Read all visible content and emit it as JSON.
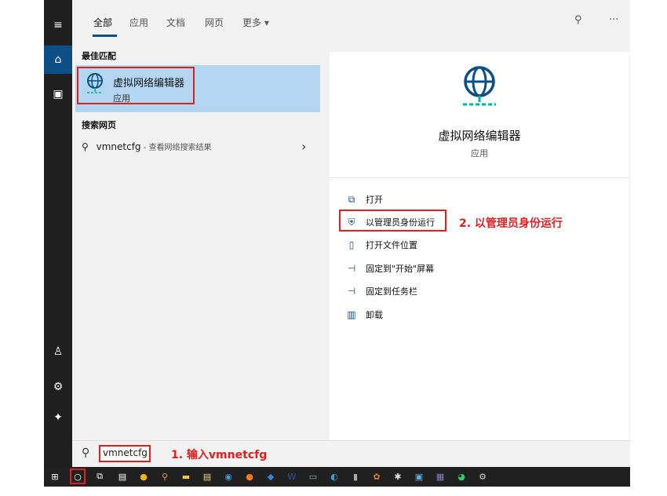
{
  "tabs": [
    "全部",
    "应用",
    "文档",
    "网页",
    "更多"
  ],
  "more_arrow": "▾",
  "top_icons": {
    "feedback": "⚲",
    "more": "···"
  },
  "left_bar": [
    "menu-icon",
    "home-icon",
    "document-icon",
    "user-icon",
    "settings-icon",
    "power-icon"
  ],
  "best_match": {
    "header": "最佳匹配",
    "name": "虚拟网络编辑器",
    "type": "应用"
  },
  "web": {
    "header": "搜索网页",
    "query": "vmnetcfg",
    "suffix": " - 查看网络搜索结果",
    "arrow": "›"
  },
  "detail": {
    "name": "虚拟网络编辑器",
    "type": "应用",
    "actions": [
      "打开",
      "以管理员身份运行",
      "打开文件位置",
      "固定到\"开始\"屏幕",
      "固定到任务栏",
      "卸载"
    ]
  },
  "annotations": {
    "step1": "1. 输入vmnetcfg",
    "step2": "2. 以管理员身份运行"
  },
  "search": {
    "value": "vmnetcfg"
  },
  "taskbar_apps": [
    "windows-icon",
    "cortana-icon",
    "task-view-icon",
    "store-icon",
    "chrome-icon",
    "search-app-icon",
    "explorer-icon",
    "notepad-icon",
    "app-icon",
    "firefox-icon",
    "editor-icon",
    "word-icon",
    "remote-icon",
    "browser-icon",
    "notes-icon",
    "media-icon",
    "settings-icon",
    "monitor-icon",
    "archive-icon",
    "wechat-icon",
    "tool-icon"
  ],
  "colors": {
    "accent": "#0b4f86",
    "highlight": "#b3d7f2",
    "annotation": "#e02020",
    "teal": "#00b4a0"
  }
}
